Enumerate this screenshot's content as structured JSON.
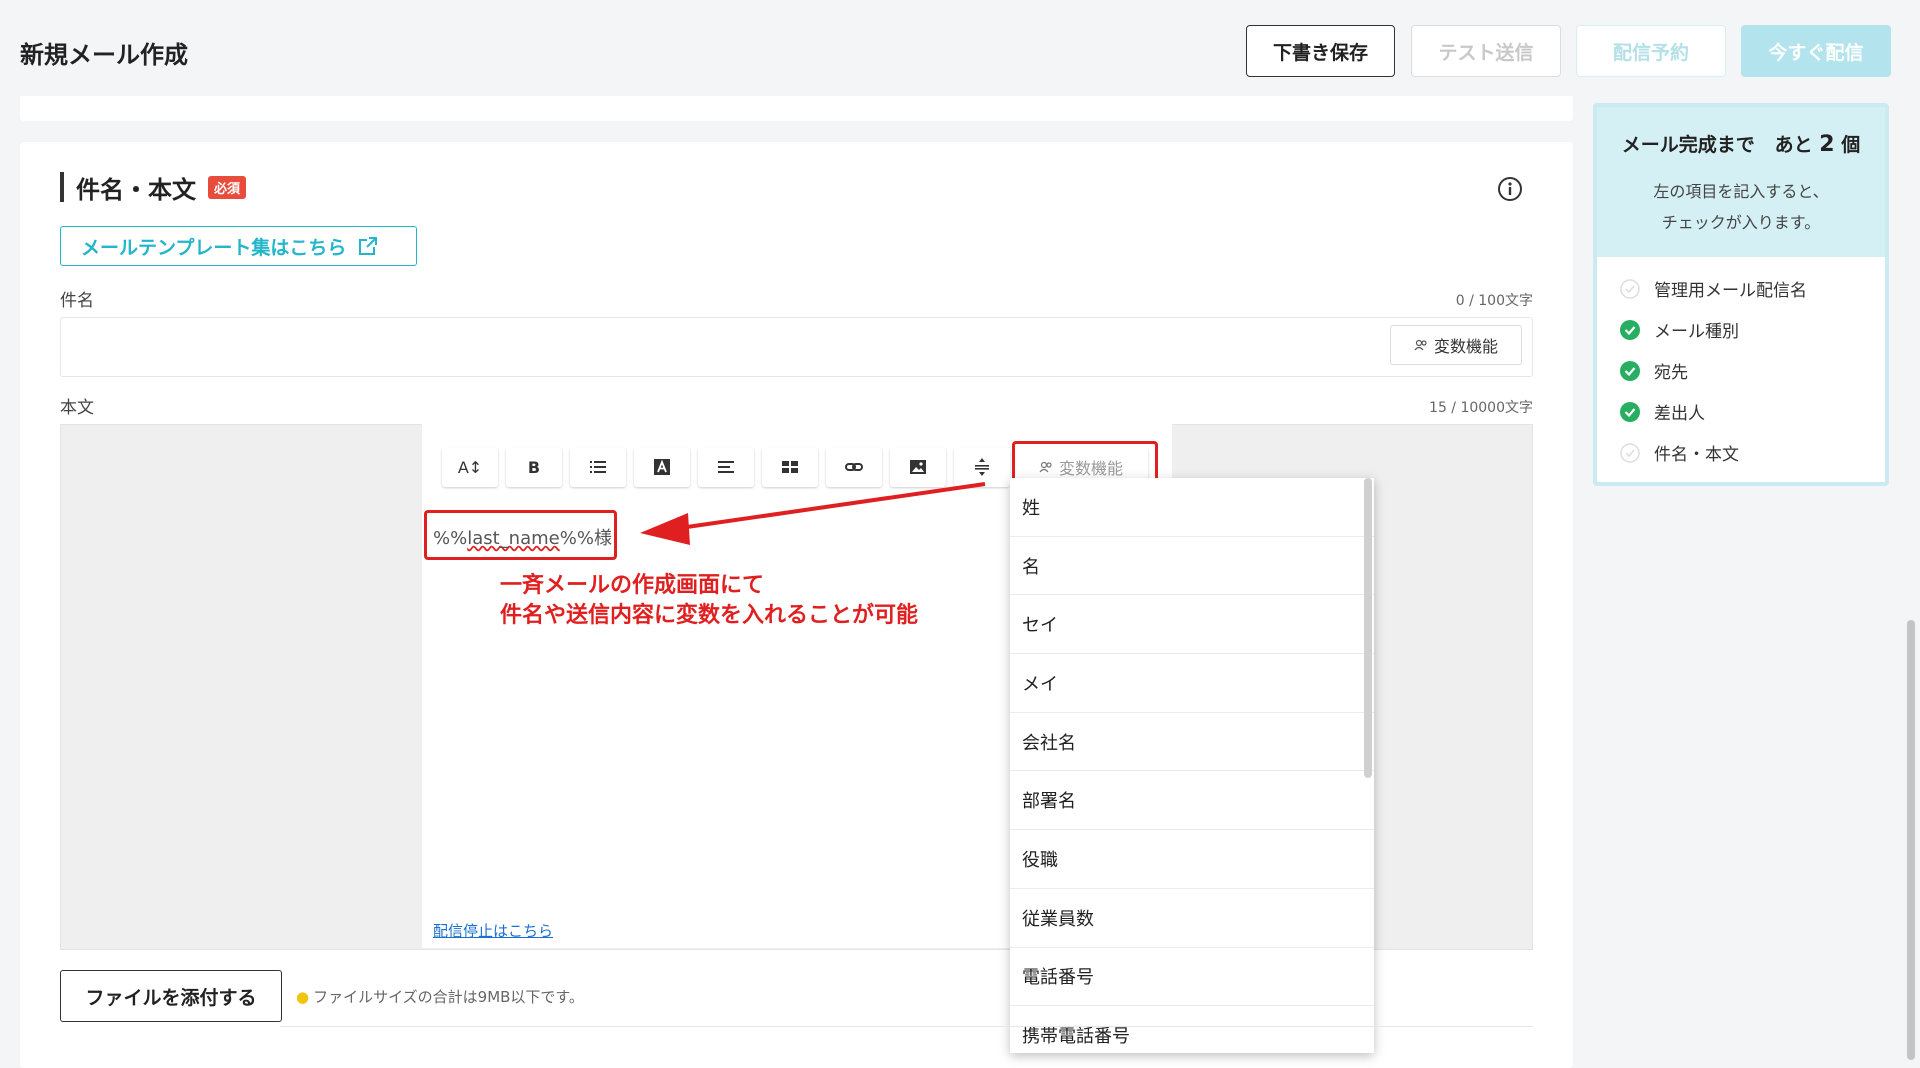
{
  "header": {
    "title": "新規メール作成",
    "buttons": {
      "draft": "下書き保存",
      "test": "テスト送信",
      "schedule": "配信予約",
      "send": "今すぐ配信"
    }
  },
  "section": {
    "title": "件名・本文",
    "required_badge": "必須",
    "template_link": "メールテンプレート集はこちら"
  },
  "subject": {
    "label": "件名",
    "counter": "0 / 100文字",
    "variable_button": "変数機能"
  },
  "body": {
    "label": "本文",
    "counter": "15 / 10000文字",
    "toolbar": [
      "A↕",
      "B",
      "list",
      "A",
      "align",
      "table",
      "link",
      "image",
      "spacing"
    ],
    "variable_button": "変数機能",
    "content_prefix": "%%",
    "content_var": "last_name",
    "content_suffix": "%%様",
    "unsubscribe_link": "配信停止はこちら"
  },
  "annotation": {
    "line1": "一斉メールの作成画面にて",
    "line2": "件名や送信内容に変数を入れることが可能",
    "color": "#e02020"
  },
  "variable_dropdown": {
    "items": [
      "姓",
      "名",
      "セイ",
      "メイ",
      "会社名",
      "部署名",
      "役職",
      "従業員数",
      "電話番号",
      "携帯電話番号"
    ]
  },
  "attachment": {
    "button": "ファイルを添付する",
    "hint": "ファイルサイズの合計は9MB以下です。"
  },
  "checklist": {
    "title": "メール完成まで",
    "remaining_prefix": "あと",
    "remaining_count": "2",
    "remaining_suffix": "個",
    "desc_line1": "左の項目を記入すると、",
    "desc_line2": "チェックが入ります。",
    "items": [
      {
        "label": "管理用メール配信名",
        "done": false
      },
      {
        "label": "メール種別",
        "done": true
      },
      {
        "label": "宛先",
        "done": true
      },
      {
        "label": "差出人",
        "done": true
      },
      {
        "label": "件名・本文",
        "done": false
      }
    ]
  },
  "colors": {
    "accent": "#23b5c9",
    "success": "#27ae60",
    "danger": "#e74c3c"
  }
}
